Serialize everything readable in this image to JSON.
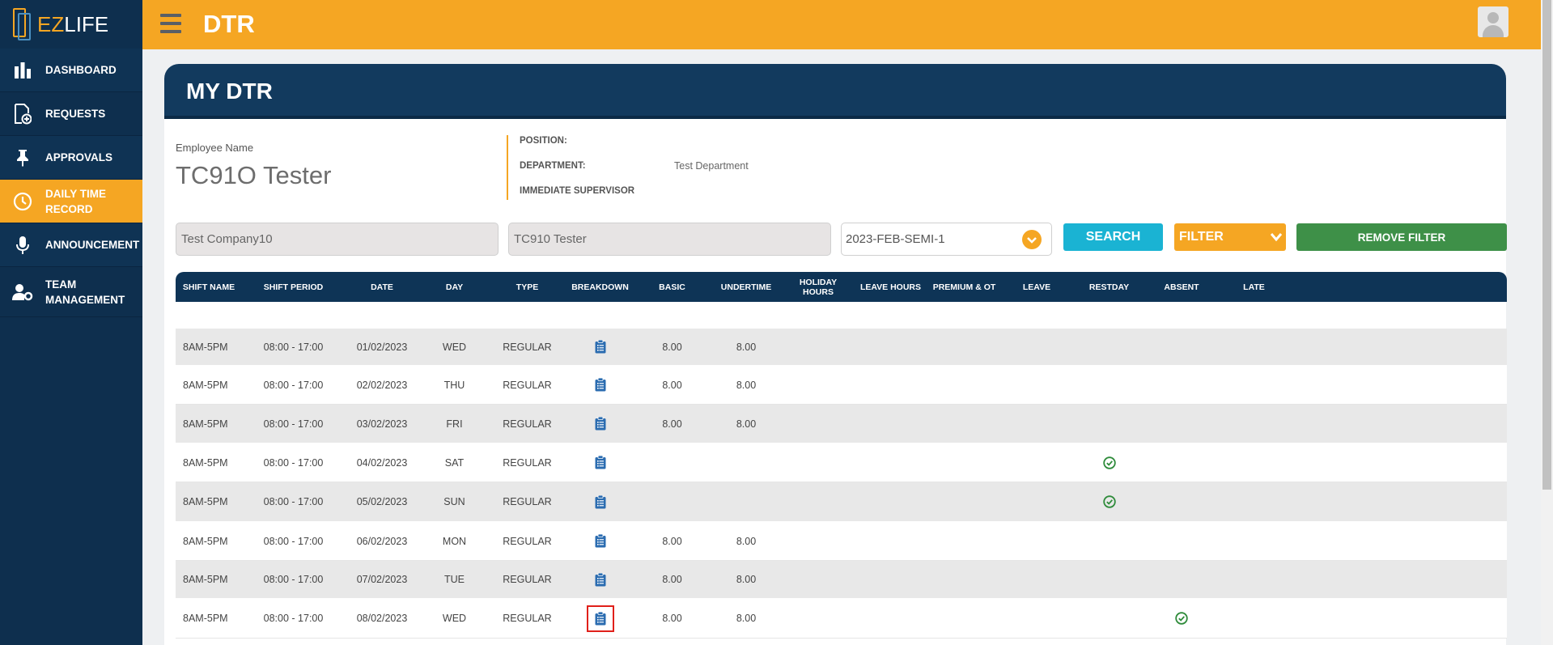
{
  "app": {
    "logo_prefix": "EZ",
    "logo_suffix": "LIFE",
    "title": "DTR"
  },
  "sidebar": {
    "items": [
      {
        "label": "DASHBOARD",
        "icon": "bar-chart-icon"
      },
      {
        "label": "REQUESTS",
        "icon": "document-add-icon"
      },
      {
        "label": "APPROVALS",
        "icon": "pin-icon"
      },
      {
        "label": "DAILY TIME RECORD",
        "icon": "clock-icon",
        "active": true
      },
      {
        "label": "ANNOUNCEMENT",
        "icon": "microphone-icon"
      },
      {
        "label": "TEAM MANAGEMENT",
        "icon": "user-gear-icon"
      }
    ]
  },
  "page": {
    "title": "MY DTR"
  },
  "employee": {
    "name_label": "Employee Name",
    "name": "TC91O Tester",
    "position_label": "POSITION:",
    "position": "",
    "department_label": "DEPARTMENT:",
    "department": "Test Department",
    "supervisor_label": "IMMEDIATE SUPERVISOR",
    "supervisor": ""
  },
  "filters": {
    "company": "Test Company10",
    "employee": "TC910 Tester",
    "period": "2023-FEB-SEMI-1",
    "search_label": "SEARCH",
    "filter_label": "FILTER",
    "remove_filter_label": "REMOVE FILTER"
  },
  "table": {
    "columns": [
      "SHIFT NAME",
      "SHIFT PERIOD",
      "DATE",
      "DAY",
      "TYPE",
      "BREAKDOWN",
      "BASIC",
      "UNDERTIME",
      "HOLIDAY HOURS",
      "LEAVE HOURS",
      "PREMIUM & OT",
      "LEAVE",
      "RESTDAY",
      "ABSENT",
      "LATE"
    ],
    "rows": [
      {
        "shift": "8AM-5PM",
        "period": "08:00 - 17:00",
        "date": "01/02/2023",
        "day": "WED",
        "type": "REGULAR",
        "basic": "8.00",
        "undertime": "8.00",
        "restday": false,
        "absent": false
      },
      {
        "shift": "8AM-5PM",
        "period": "08:00 - 17:00",
        "date": "02/02/2023",
        "day": "THU",
        "type": "REGULAR",
        "basic": "8.00",
        "undertime": "8.00",
        "restday": false,
        "absent": false
      },
      {
        "shift": "8AM-5PM",
        "period": "08:00 - 17:00",
        "date": "03/02/2023",
        "day": "FRI",
        "type": "REGULAR",
        "basic": "8.00",
        "undertime": "8.00",
        "restday": false,
        "absent": false
      },
      {
        "shift": "8AM-5PM",
        "period": "08:00 - 17:00",
        "date": "04/02/2023",
        "day": "SAT",
        "type": "REGULAR",
        "basic": "",
        "undertime": "",
        "restday": true,
        "absent": false
      },
      {
        "shift": "8AM-5PM",
        "period": "08:00 - 17:00",
        "date": "05/02/2023",
        "day": "SUN",
        "type": "REGULAR",
        "basic": "",
        "undertime": "",
        "restday": true,
        "absent": false
      },
      {
        "shift": "8AM-5PM",
        "period": "08:00 - 17:00",
        "date": "06/02/2023",
        "day": "MON",
        "type": "REGULAR",
        "basic": "8.00",
        "undertime": "8.00",
        "restday": false,
        "absent": false
      },
      {
        "shift": "8AM-5PM",
        "period": "08:00 - 17:00",
        "date": "07/02/2023",
        "day": "TUE",
        "type": "REGULAR",
        "basic": "8.00",
        "undertime": "8.00",
        "restday": false,
        "absent": false
      },
      {
        "shift": "8AM-5PM",
        "period": "08:00 - 17:00",
        "date": "08/02/2023",
        "day": "WED",
        "type": "REGULAR",
        "basic": "8.00",
        "undertime": "8.00",
        "restday": false,
        "absent": true,
        "highlighted": true
      }
    ]
  },
  "colors": {
    "accent": "#f5a623",
    "navy": "#0e2f4e",
    "header": "#123a5e",
    "teal": "#1ab3d3",
    "green": "#3e9048",
    "icon_blue": "#2b6cb0",
    "check_green": "#2e8b3a"
  }
}
